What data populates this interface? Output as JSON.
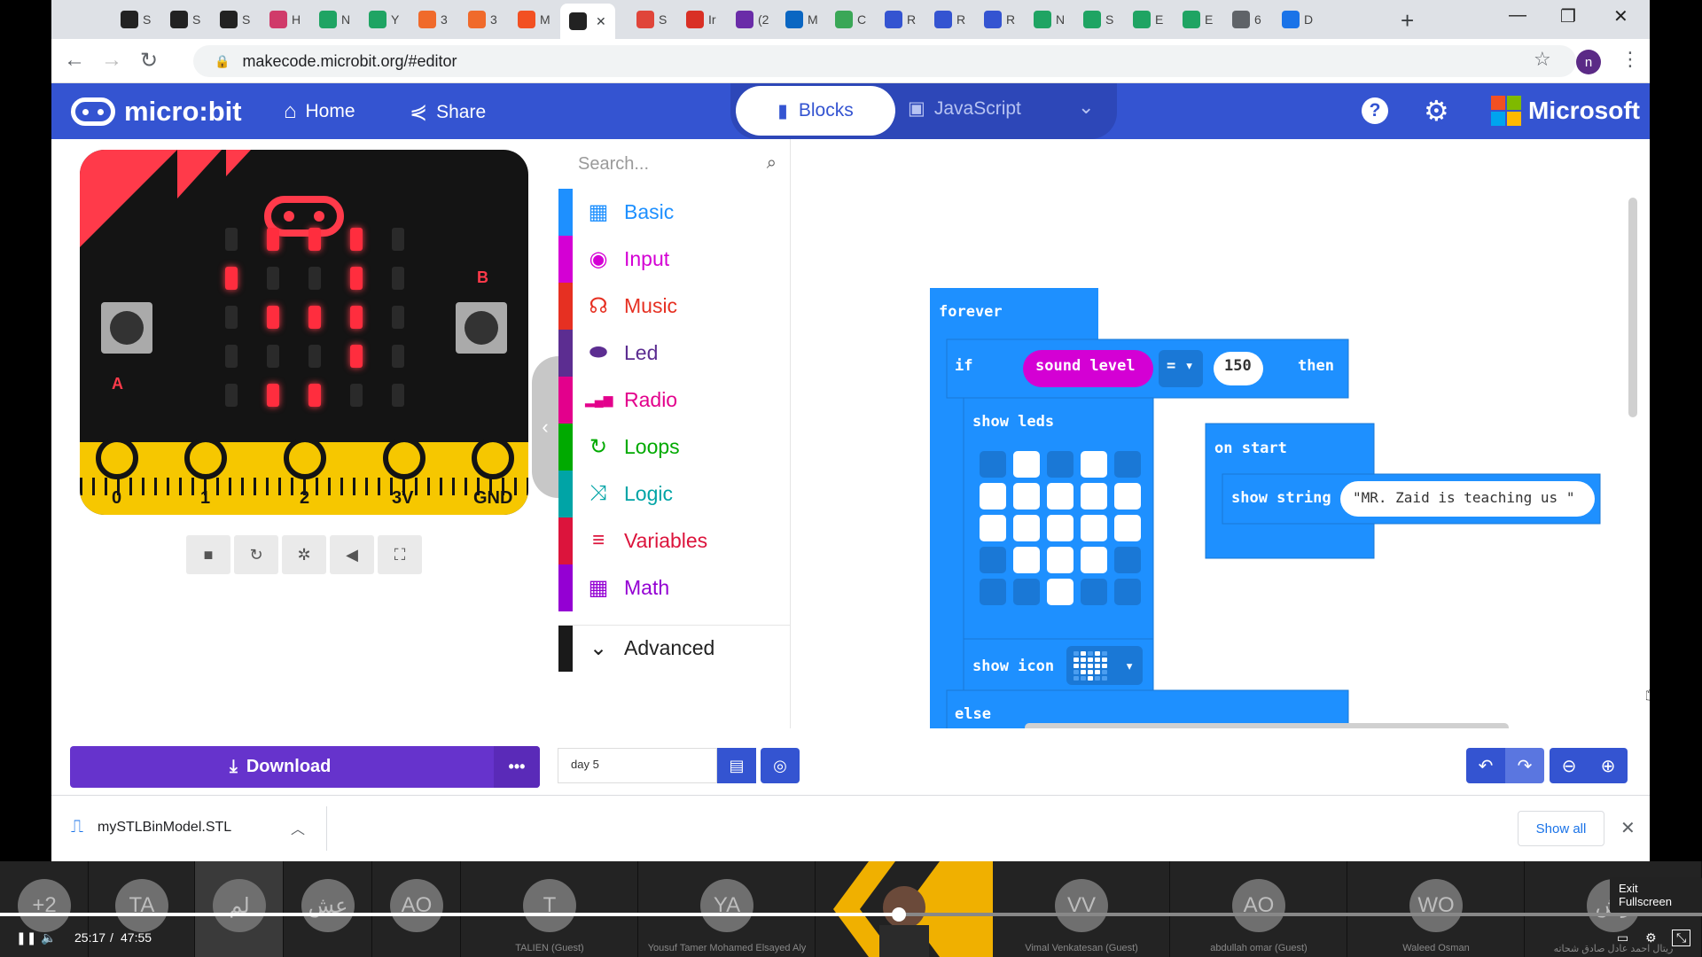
{
  "browser": {
    "tabs": [
      {
        "label": "S",
        "icon": "circle-dark-icon",
        "color": "#222222"
      },
      {
        "label": "S",
        "icon": "circle-dark-icon",
        "color": "#222222"
      },
      {
        "label": "S",
        "icon": "circle-dark-icon",
        "color": "#222222"
      },
      {
        "label": "H",
        "icon": "hoot-icon",
        "color": "#d03b6a"
      },
      {
        "label": "N",
        "icon": "drive-icon",
        "color": "#1fa463"
      },
      {
        "label": "Y",
        "icon": "drive-icon",
        "color": "#1fa463"
      },
      {
        "label": "3",
        "icon": "orange-icon",
        "color": "#f06a2b"
      },
      {
        "label": "3",
        "icon": "orange-icon",
        "color": "#f06a2b"
      },
      {
        "label": "M",
        "icon": "microsoft-icon",
        "color": "#f25022"
      },
      {
        "label": "",
        "icon": "microbit-icon",
        "color": "#222222",
        "active": true
      },
      {
        "label": "S",
        "icon": "shield-icon",
        "color": "#e0453a"
      },
      {
        "label": "Ir",
        "icon": "gmail-icon",
        "color": "#d93025"
      },
      {
        "label": "(2",
        "icon": "mail-icon",
        "color": "#6a2ca8"
      },
      {
        "label": "M",
        "icon": "outlook-icon",
        "color": "#0a66c2"
      },
      {
        "label": "C",
        "icon": "chat-icon",
        "color": "#3aa757"
      },
      {
        "label": "R",
        "icon": "form-icon",
        "color": "#3454d1"
      },
      {
        "label": "R",
        "icon": "form-icon",
        "color": "#3454d1"
      },
      {
        "label": "R",
        "icon": "form-icon",
        "color": "#3454d1"
      },
      {
        "label": "N",
        "icon": "drive-icon",
        "color": "#1fa463"
      },
      {
        "label": "S",
        "icon": "drive-icon",
        "color": "#1fa463"
      },
      {
        "label": "E",
        "icon": "drive-icon",
        "color": "#1fa463"
      },
      {
        "label": "E",
        "icon": "drive-icon",
        "color": "#1fa463"
      },
      {
        "label": "6",
        "icon": "globe-icon",
        "color": "#5f6368"
      },
      {
        "label": "D",
        "icon": "download-icon",
        "color": "#1a73e8"
      }
    ],
    "url": "makecode.microbit.org/#editor",
    "profile_initial": "n"
  },
  "header": {
    "logo_text": "micro:bit",
    "home_label": "Home",
    "share_label": "Share",
    "blocks_label": "Blocks",
    "javascript_label": "JavaScript",
    "microsoft_label": "Microsoft",
    "accent": "#3454d1"
  },
  "simulator": {
    "pin_labels": [
      "0",
      "1",
      "2",
      "3V",
      "GND"
    ],
    "button_a": "A",
    "button_b": "B"
  },
  "toolbox": {
    "search_placeholder": "Search...",
    "categories": [
      {
        "label": "Basic",
        "color": "#1e90ff",
        "icon": "grid-icon"
      },
      {
        "label": "Input",
        "color": "#d400d4",
        "icon": "target-icon"
      },
      {
        "label": "Music",
        "color": "#e63022",
        "icon": "headphones-icon"
      },
      {
        "label": "Led",
        "color": "#5c2d91",
        "icon": "toggle-icon"
      },
      {
        "label": "Radio",
        "color": "#e3008c",
        "icon": "signal-icon"
      },
      {
        "label": "Loops",
        "color": "#00aa00",
        "icon": "refresh-icon"
      },
      {
        "label": "Logic",
        "color": "#00a4a6",
        "icon": "shuffle-icon"
      },
      {
        "label": "Variables",
        "color": "#dc143c",
        "icon": "lines-icon"
      },
      {
        "label": "Math",
        "color": "#9400d3",
        "icon": "calculator-icon"
      }
    ],
    "advanced_label": "Advanced"
  },
  "workspace": {
    "forever": "forever",
    "if": "if",
    "sound_level": "sound level",
    "operator": "=",
    "value": "150",
    "then": "then",
    "show_leds": "show leds",
    "show_icon": "show icon",
    "else": "else",
    "on_start": "on start",
    "show_string": "show string",
    "string_value": "\"MR. Zaid is teaching us \""
  },
  "bottombar": {
    "download_label": "Download",
    "project_name": "day 5"
  },
  "downloads": {
    "file_name": "mySTLBinModel.STL",
    "show_all": "Show all"
  },
  "meeting": {
    "participants": [
      {
        "initials": "+2",
        "name": ""
      },
      {
        "initials": "TA",
        "name": ""
      },
      {
        "initials": "لم",
        "name": ""
      },
      {
        "initials": "عش",
        "name": ""
      },
      {
        "initials": "AO",
        "name": ""
      },
      {
        "initials": "T",
        "name": "TALIEN (Guest)"
      },
      {
        "initials": "YA",
        "name": "Yousuf Tamer Mohamed Elsayed Aly"
      },
      {
        "initials": "VV",
        "name": "Vimal Venkatesan (Guest)"
      },
      {
        "initials": "AO",
        "name": "abdullah omar (Guest)"
      },
      {
        "initials": "WO",
        "name": "Waleed Osman"
      },
      {
        "initials": "رش",
        "name": "ريتال احمد عادل صادق شحاته"
      }
    ],
    "time_current": "25:17",
    "time_separator": "/",
    "time_total": "47:55",
    "progress_fraction": 0.528,
    "exit_fullscreen": "Exit Fullscreen"
  }
}
